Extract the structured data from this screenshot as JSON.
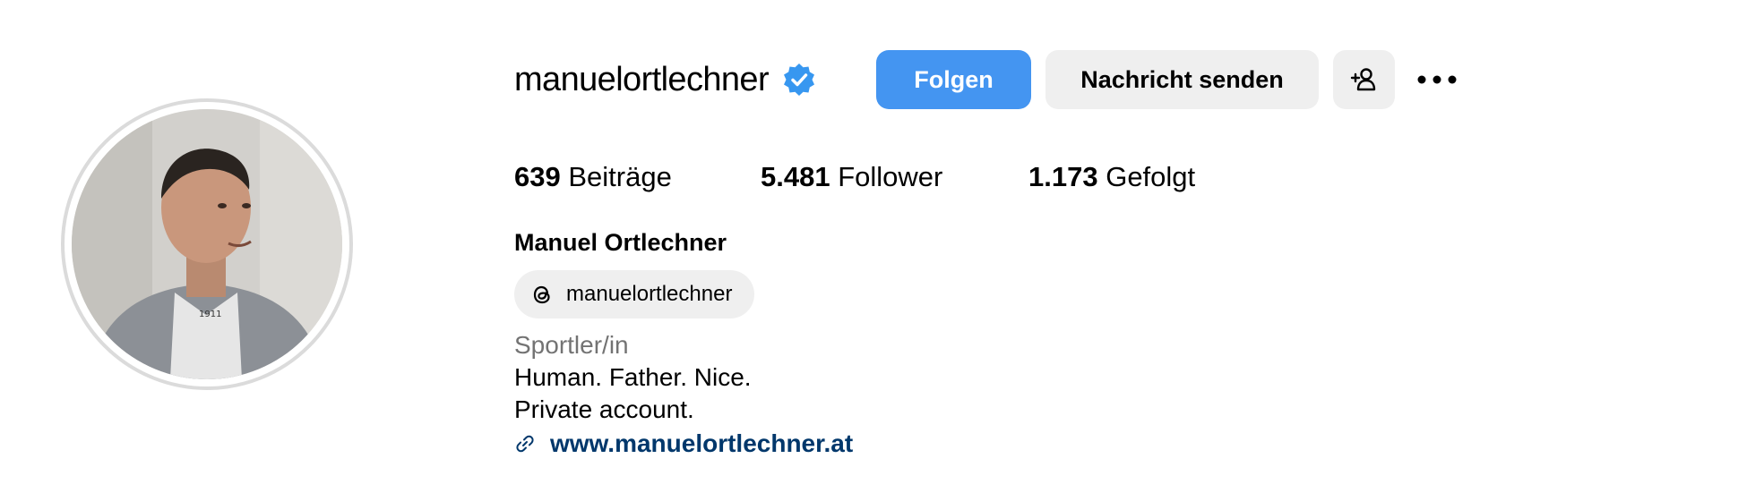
{
  "profile": {
    "username": "manuelortlechner",
    "verified": true,
    "full_name": "Manuel Ortlechner",
    "threads_handle": "manuelortlechner",
    "category": "Sportler/in",
    "bio_lines": [
      "Human. Father. Nice.",
      "Private account."
    ],
    "website": "www.manuelortlechner.at"
  },
  "actions": {
    "follow_label": "Folgen",
    "message_label": "Nachricht senden",
    "add_user_icon": "person-plus-icon",
    "more_icon": "ellipsis-icon"
  },
  "stats": {
    "posts": {
      "count": "639",
      "label": "Beiträge"
    },
    "followers": {
      "count": "5.481",
      "label": "Follower"
    },
    "following": {
      "count": "1.173",
      "label": "Gefolgt"
    }
  },
  "colors": {
    "accent": "#4495f1",
    "verified_badge": "#3797f0",
    "link": "#00376b",
    "secondary_text": "#737373",
    "button_bg": "#efefef"
  }
}
